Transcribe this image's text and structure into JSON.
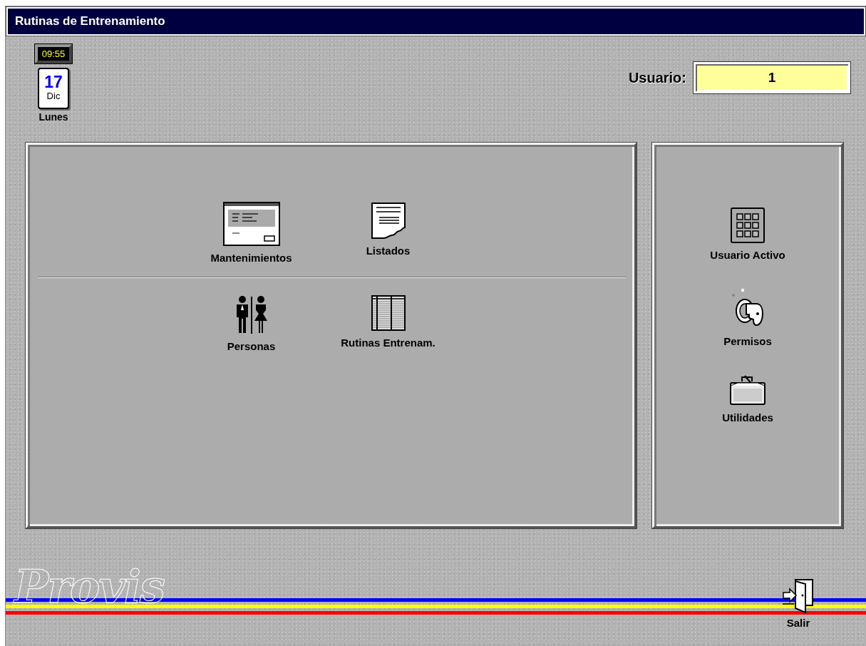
{
  "window": {
    "title": "Rutinas de Entrenamiento"
  },
  "clock": {
    "time": "09:55"
  },
  "calendar": {
    "day": "17",
    "month": "Dic",
    "weekday": "Lunes"
  },
  "user": {
    "label": "Usuario:",
    "value": "1"
  },
  "main_panel": {
    "sections": [
      {
        "items": [
          {
            "label": "Mantenimientos",
            "kind": "form"
          },
          {
            "label": "Listados",
            "kind": "document"
          }
        ]
      },
      {
        "items": [
          {
            "label": "Personas",
            "kind": "people"
          },
          {
            "label": "Rutinas Entrenam.",
            "kind": "table"
          }
        ]
      }
    ]
  },
  "side_panel": {
    "items": [
      {
        "label": "Usuario Activo",
        "kind": "keypad"
      },
      {
        "label": "Permisos",
        "kind": "key"
      },
      {
        "label": "Utilidades",
        "kind": "briefcase"
      }
    ]
  },
  "logo": {
    "text": "Provis"
  },
  "exit": {
    "label": "Salir"
  }
}
